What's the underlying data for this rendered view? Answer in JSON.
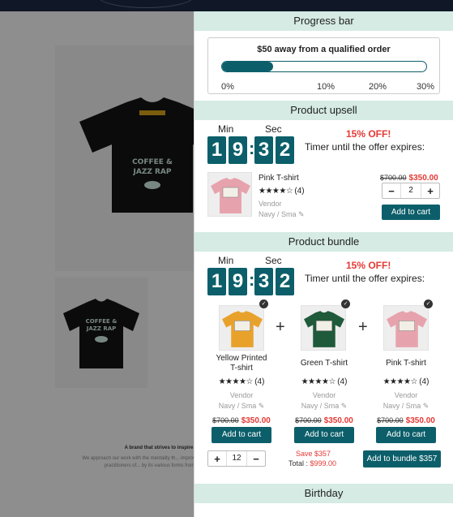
{
  "sections": {
    "progress": "Progress bar",
    "upsell": "Product upsell",
    "bundle": "Product bundle",
    "birthday": "Birthday"
  },
  "progress": {
    "title": "$50 away from a qualified order",
    "fill_fraction": 0.25,
    "ticks": [
      "0%",
      "10%",
      "20%",
      "30%"
    ]
  },
  "timer": {
    "min_label": "Min",
    "sec_label": "Sec",
    "digits": [
      "1",
      "9",
      "3",
      "2"
    ],
    "offer_pct": "15% OFF!",
    "offer_text": "Timer until the offer expires:"
  },
  "upsell": {
    "name": "Pink T-shirt",
    "stars": "★★★★☆",
    "reviews": "(4)",
    "vendor": "Vendor",
    "variant": "Navy / Sma",
    "old_price": "$700.00",
    "new_price": "$350.00",
    "qty": "2",
    "minus": "−",
    "plus": "+",
    "add": "Add to cart"
  },
  "bundle": {
    "items": [
      {
        "name": "Yellow Printed T-shirt",
        "stars": "★★★★☆",
        "reviews": "(4)",
        "vendor": "Vendor",
        "variant": "Navy / Sma",
        "old_price": "$700.00",
        "new_price": "$350.00",
        "add": "Add to cart"
      },
      {
        "name": "Green T-shirt",
        "stars": "★★★★☆",
        "reviews": "(4)",
        "vendor": "Vendor",
        "variant": "Navy / Sma",
        "old_price": "$700.00",
        "new_price": "$350.00",
        "add": "Add to cart"
      },
      {
        "name": "Pink T-shirt",
        "stars": "★★★★☆",
        "reviews": "(4)",
        "vendor": "Vendor",
        "variant": "Navy / Sma",
        "old_price": "$700.00",
        "new_price": "$350.00",
        "add": "Add to cart"
      }
    ],
    "plus_sign": "+",
    "check": "✓",
    "qty": "12",
    "qty_plus": "+",
    "qty_minus": "−",
    "save": "Save $357",
    "total_label": "Total : ",
    "total_value": "$999.00",
    "add_bundle": "Add to bundle $357"
  },
  "background": {
    "caption_title": "A brand that strives to inspire",
    "caption_body": "We approach our work with the mentality th... improve our craft. We are practitioners of... by its various forms from art, desi"
  },
  "colors": {
    "accent": "#0c5f6a",
    "section_bg": "#d5ebe4",
    "sale_red": "#e53935",
    "yellow_shirt": "#e8a22b",
    "green_shirt": "#1f5a3a",
    "pink_shirt": "#e7a3ad"
  },
  "icons": {
    "edit": "pencil-icon",
    "check": "check-circle-icon"
  }
}
